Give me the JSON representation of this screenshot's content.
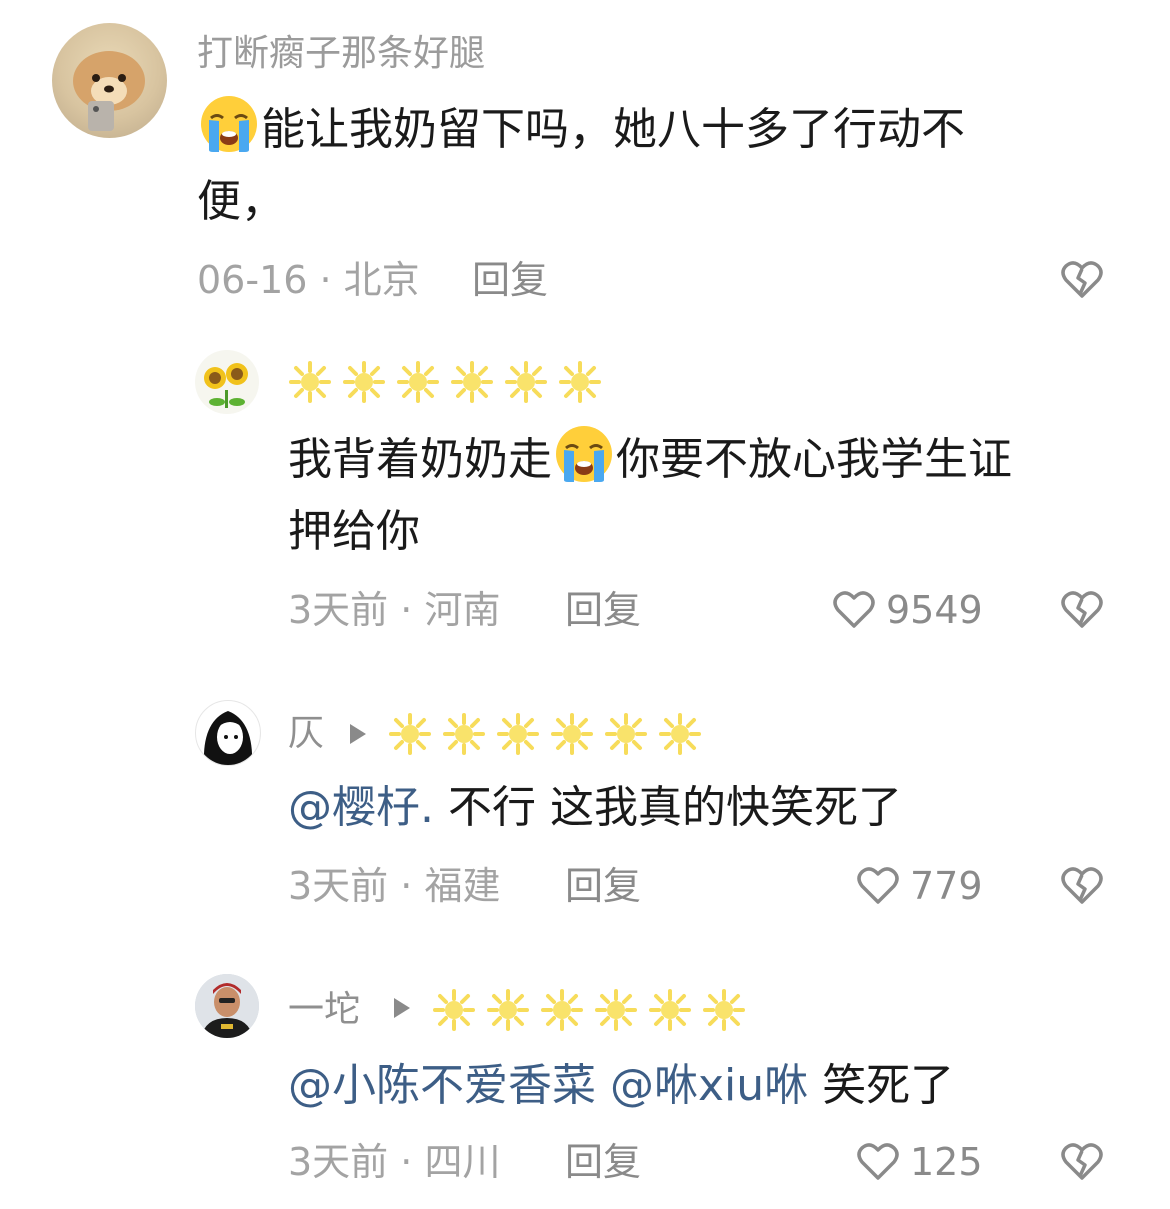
{
  "comments": [
    {
      "username": "打断瘸子那条好腿",
      "text_part1": "能让我奶留下吗，她八十多了行动不",
      "text_part2": "便，",
      "date": "06-16",
      "location": "北京",
      "reply_label": "回复"
    },
    {
      "username": "☀☀☀☀☀☀",
      "text_part1": "我背着奶奶走",
      "text_part2": "你要不放心我学生证",
      "text_part3": "押给你",
      "date": "3天前",
      "location": "河南",
      "reply_label": "回复",
      "likes": "9549"
    },
    {
      "username": "仄",
      "mention": "@樱杍.",
      "text": " 不行 这我真的快笑死了",
      "date": "3天前",
      "location": "福建",
      "reply_label": "回复",
      "likes": "779"
    },
    {
      "username": "一坨",
      "mention1": "@小陈不爱香菜",
      "mention2": "@咻xiu咻",
      "text": " 笑死了",
      "date": "3天前",
      "location": "四川",
      "reply_label": "回复",
      "likes": "125"
    }
  ],
  "separator": " · ",
  "colors": {
    "username": "#9b9b9b",
    "text": "#1a1a1a",
    "mention": "#3d5e86",
    "meta": "#a3a3a3",
    "star": "#f6e27a"
  },
  "icons": {
    "cry_emoji": "loudly-crying-face",
    "like": "heart-outline",
    "dislike": "broken-heart-outline",
    "star": "sun-star",
    "play": "play-triangle"
  }
}
